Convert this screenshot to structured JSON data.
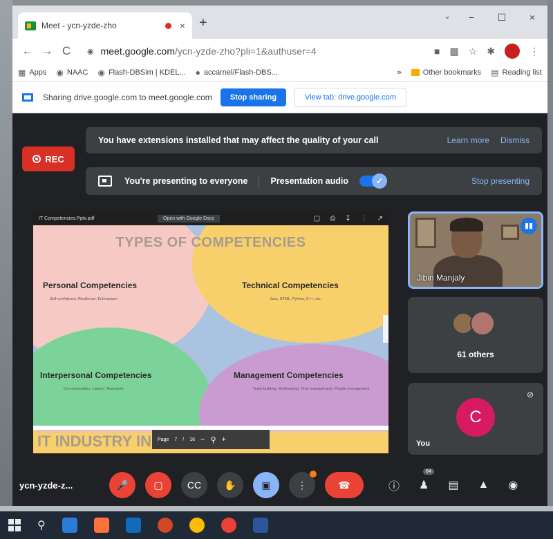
{
  "tab": {
    "title": "Meet - ycn-yzde-zho",
    "close": "×",
    "new_tab": "+"
  },
  "window_controls": {
    "minimize": "−",
    "maximize": "☐",
    "close": "×",
    "dropdown": "⌄"
  },
  "toolbar": {
    "back": "←",
    "forward": "→",
    "reload": "C",
    "url_host": "meet.google.com",
    "url_path": "/ycn-yzde-zho?pli=1&authuser=4"
  },
  "bookmarks": [
    {
      "label": "Apps",
      "icon": "apps-icon"
    },
    {
      "label": "NAAC",
      "icon": "globe-icon"
    },
    {
      "label": "Flash-DBSim | KDEL...",
      "icon": "globe-icon"
    },
    {
      "label": "accarnel/Flash-DBS...",
      "icon": "github-icon"
    }
  ],
  "bookmarks_right": {
    "other": "Other bookmarks",
    "reading": "Reading list"
  },
  "sharebar": {
    "text": "Sharing drive.google.com to meet.google.com",
    "stop_label": "Stop sharing",
    "view_label": "View tab: drive.google.com"
  },
  "rec_label": "REC",
  "ext_banner": {
    "text": "You have extensions installed that may affect the quality of your call",
    "learn_more": "Learn more",
    "dismiss": "Dismiss"
  },
  "present_banner": {
    "text": "You're presenting to everyone",
    "audio_label": "Presentation audio",
    "audio_on": true,
    "stop_label": "Stop presenting"
  },
  "slide_viewer": {
    "filename": "IT Competencies.Pptx.pdf",
    "open_with": "Open with Google Docs",
    "page_label": "Page",
    "page_num": "7",
    "page_sep": "/",
    "page_total": "16",
    "zoom_out": "−",
    "zoom_in": "+"
  },
  "slide": {
    "title": "TYPES OF COMPETENCIES",
    "items": [
      {
        "heading": "Personal Competencies",
        "sub": "Self-confidence, Resilience, Enthusiasm"
      },
      {
        "heading": "Technical Competencies",
        "sub": "Java, HTML, Python, C++, etc."
      },
      {
        "heading": "Interpersonal Competencies",
        "sub": "Communication, Liaison, Teamwork"
      },
      {
        "heading": "Management Competencies",
        "sub": "Team building, Multitasking, Time management, People management"
      }
    ],
    "next_title": "IT INDUSTRY IN"
  },
  "participants": {
    "speaker_name": "Jibin Manjaly",
    "others_label": "61 others",
    "you_initial": "C",
    "you_label": "You"
  },
  "controls": {
    "meeting_code": "ycn-yzde-z...",
    "people_count": "64"
  },
  "colors": {
    "accent": "#1a73e8",
    "danger": "#ea4335",
    "meet_bg": "#202124",
    "tile_bg": "#3c4043",
    "avatar": "#d81b60"
  }
}
